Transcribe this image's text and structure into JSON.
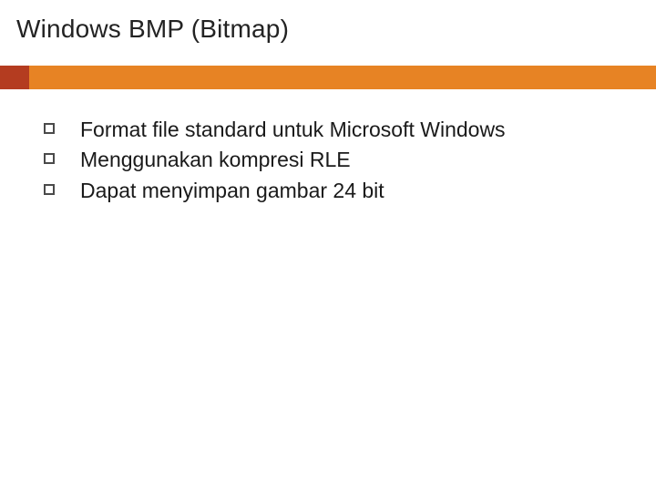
{
  "slide": {
    "title": "Windows BMP (Bitmap)",
    "bullets": [
      "Format file standard untuk Microsoft Windows",
      "Menggunakan kompresi RLE",
      "Dapat menyimpan gambar 24 bit"
    ]
  },
  "colors": {
    "accent": "#e78324",
    "accent_dark": "#b43c20"
  }
}
